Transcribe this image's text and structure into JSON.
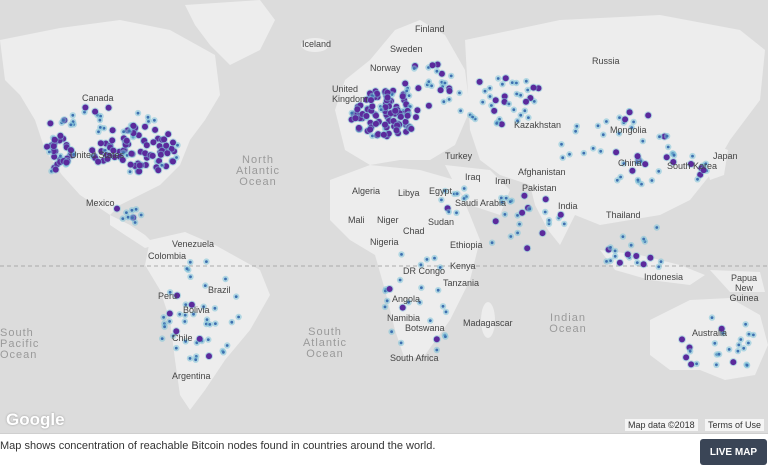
{
  "map": {
    "labels": {
      "finland": "Finland",
      "iceland": "Iceland",
      "sweden": "Sweden",
      "norway": "Norway",
      "russia": "Russia",
      "united_kingdom": "United Kingdom",
      "canada": "Canada",
      "united_states": "United States",
      "kazakhstan": "Kazakhstan",
      "mongolia": "Mongolia",
      "turkey": "Turkey",
      "china": "China",
      "south_korea": "South Korea",
      "japan": "Japan",
      "iraq": "Iraq",
      "iran": "Iran",
      "afghanistan": "Afghanistan",
      "pakistan": "Pakistan",
      "algeria": "Algeria",
      "libya": "Libya",
      "egypt": "Egypt",
      "saudi_arabia": "Saudi Arabia",
      "india": "India",
      "thailand": "Thailand",
      "mexico": "Mexico",
      "mali": "Mali",
      "niger": "Niger",
      "chad": "Chad",
      "sudan": "Sudan",
      "venezuela": "Venezuela",
      "colombia": "Colombia",
      "nigeria": "Nigeria",
      "ethiopia": "Ethiopia",
      "dr_congo": "DR Congo",
      "kenya": "Kenya",
      "indonesia": "Indonesia",
      "papua_new_guinea": "Papua New Guinea",
      "peru": "Peru",
      "brazil": "Brazil",
      "bolivia": "Bolivia",
      "tanzania": "Tanzania",
      "angola": "Angola",
      "namibia": "Namibia",
      "botswana": "Botswana",
      "madagascar": "Madagascar",
      "chile": "Chile",
      "south_africa": "South Africa",
      "australia": "Australia",
      "argentina": "Argentina"
    },
    "oceans": {
      "north_atlantic": "North Atlantic Ocean",
      "south_atlantic": "South Atlantic Ocean",
      "indian": "Indian Ocean",
      "south_pacific": "South Pacific Ocean"
    },
    "google_logo": "Google",
    "map_data": "Map data ©2018",
    "terms": "Terms of Use",
    "colors": {
      "land": "#ededed",
      "water": "#dcdcdc",
      "node_dense": "#5b2a9c",
      "node_sparse": "#7ec3d8"
    }
  },
  "caption": "Map shows concentration of reachable Bitcoin nodes found in countries around the world.",
  "live_map_button": "LIVE MAP"
}
